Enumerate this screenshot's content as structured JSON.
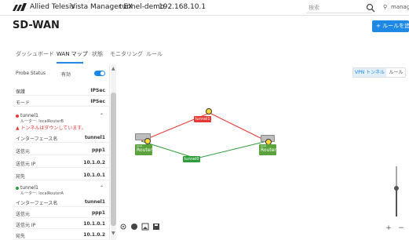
{
  "header": {
    "brand": "Allied Telesis",
    "product": "Vista Manager EX",
    "host": "tunnel-demo",
    "ip": "192.168.10.1",
    "search_placeholder": "検索",
    "user": "manager"
  },
  "page": {
    "title": "SD-WAN",
    "add_rule": "+ ルールを追加"
  },
  "tabs": [
    {
      "label": "ダッシュボード"
    },
    {
      "label": "WAN マップ"
    },
    {
      "label": "状態"
    },
    {
      "label": "モニタリング"
    },
    {
      "label": "ルール"
    }
  ],
  "left": {
    "probe_label": "Probe Status",
    "probe_value": "有効",
    "rows_top": [
      {
        "k": "保護",
        "v": "IPSec"
      },
      {
        "k": "モード",
        "v": "IPSec"
      }
    ],
    "tunnel1": {
      "name": "tunnel1",
      "route": "ルーター: localRouterB",
      "warning": "▲ トンネルはダウンしています。",
      "rows": [
        {
          "k": "インターフェース名",
          "v": "tunnel1"
        },
        {
          "k": "送信元",
          "v": "ppp1"
        },
        {
          "k": "送信元 IP",
          "v": "10.1.0.2"
        },
        {
          "k": "宛先",
          "v": "10.1.0.1"
        }
      ]
    },
    "tunnel2": {
      "name": "tunnel1",
      "route": "ルーター: localRouterA",
      "rows": [
        {
          "k": "インターフェース名",
          "v": "tunnel1"
        },
        {
          "k": "送信元",
          "v": "ppp1"
        },
        {
          "k": "送信元 IP",
          "v": "10.1.0.1"
        },
        {
          "k": "宛先",
          "v": "10.1.0.2"
        }
      ]
    }
  },
  "map": {
    "toggle_on": "VPN トンネル",
    "toggle_off": "ルール",
    "routerA_label_small": "local",
    "routerA_label": "RouterA",
    "routerB_label_small": "local",
    "routerB_label": "RouterB",
    "tunnel_top": "tunnel1",
    "tunnel_bottom": "tunnel0",
    "colors": {
      "up": "#2e9d3c",
      "down": "#e53935",
      "router_bg": "#5aa33c"
    }
  },
  "zoom": {
    "plus": "+",
    "minus": "−"
  }
}
